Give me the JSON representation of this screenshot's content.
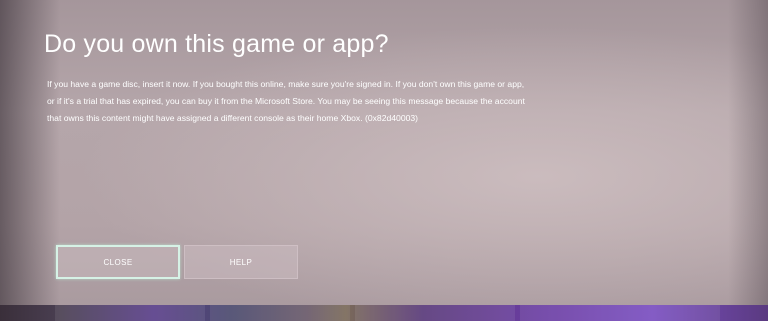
{
  "dialog": {
    "title": "Do you own this game or app?",
    "message_lines": [
      "If you have a game disc, insert it now. If you bought this online, make sure you're signed in. If you don't own this game or app,",
      "or if it's a trial that has expired, you can buy it from the Microsoft Store. You may be seeing this message because the account",
      "that owns this content might have assigned a different console as their home Xbox. (0x82d40003)"
    ],
    "buttons": {
      "close_label": "CLOSE",
      "help_label": "HELP"
    }
  },
  "colors": {
    "overlay": "#b3a3a7",
    "focus_border": "#d6f2e6",
    "text": "#ffffff"
  }
}
